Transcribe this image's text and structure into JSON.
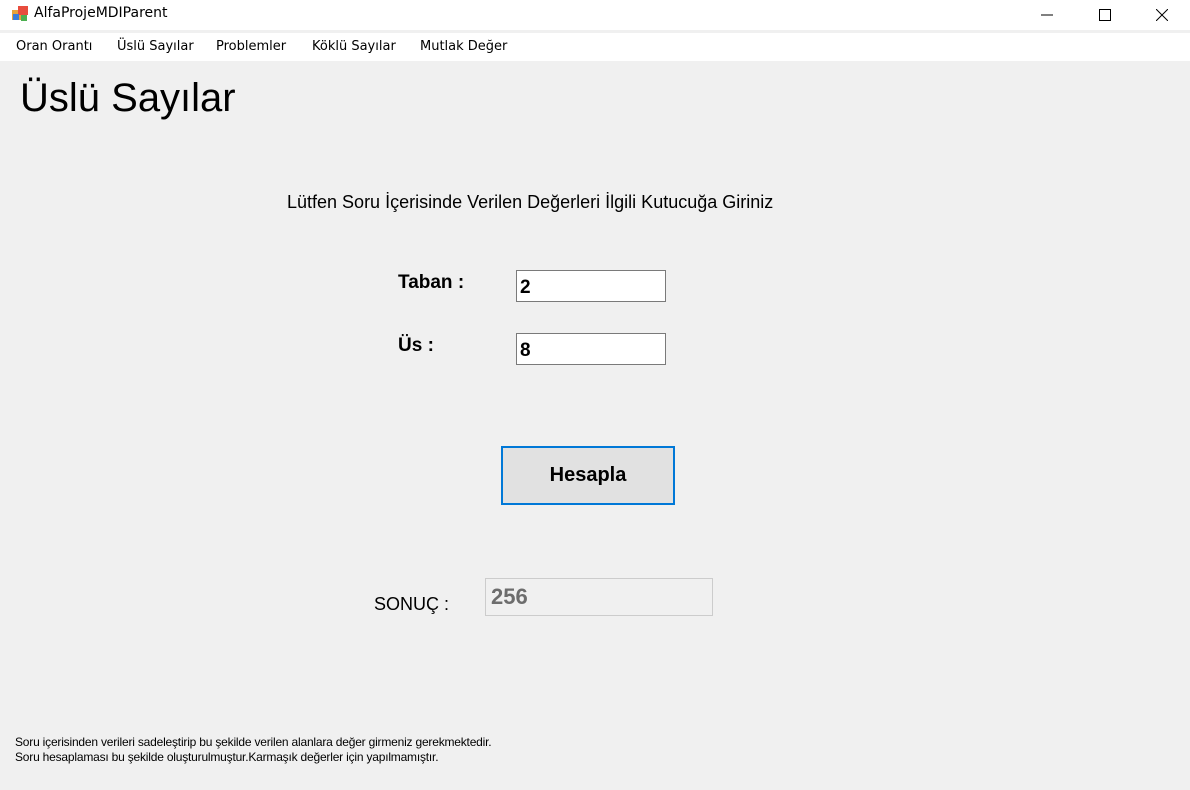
{
  "window": {
    "title": "AlfaProjeMDIParent",
    "controls": [
      "minimize",
      "maximize",
      "close"
    ]
  },
  "menu": {
    "items": [
      {
        "label": "Oran Orantı"
      },
      {
        "label": "Üslü Sayılar"
      },
      {
        "label": "Problemler"
      },
      {
        "label": "Köklü Sayılar"
      },
      {
        "label": "Mutlak Değer"
      }
    ]
  },
  "main": {
    "title": "Üslü Sayılar",
    "instruction": "Lütfen Soru İçerisinde Verilen Değerleri İlgili Kutucuğa Giriniz",
    "taban": {
      "label": "Taban :",
      "value": "2"
    },
    "us": {
      "label": "Üs :",
      "value": "8"
    },
    "calculate_button": "Hesapla",
    "result": {
      "label": "SONUÇ :",
      "value": "256"
    },
    "notes": [
      "Soru içerisinden verileri sadeleştirip bu şekilde verilen alanlara değer girmeniz gerekmektedir.",
      "Soru hesaplaması bu şekilde oluşturulmuştur.Karmaşık değerler için yapılmamıştır."
    ]
  },
  "colors": {
    "focus_border": "#0078d7",
    "window_bg": "#f0f0f0",
    "button_bg": "#e1e1e1",
    "disabled_text": "#6d6d6d"
  }
}
